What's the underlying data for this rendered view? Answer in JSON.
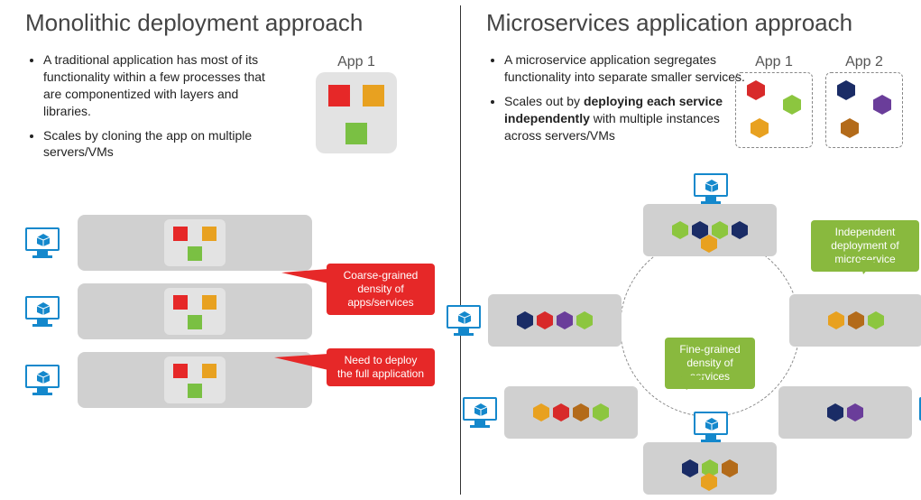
{
  "left": {
    "heading": "Monolithic deployment approach",
    "bullets": [
      "A traditional application has most of its functionality within a few processes that are componentized with layers and libraries.",
      "Scales by cloning the app on multiple servers/VMs"
    ],
    "app_label": "App 1",
    "callout1": "Coarse-grained density of apps/services",
    "callout2": "Need to deploy the full application"
  },
  "right": {
    "heading": "Microservices application approach",
    "bullet1": "A microservice application segregates functionality into separate smaller services.",
    "bullet2_pre": "Scales out by ",
    "bullet2_bold": "deploying each service independently",
    "bullet2_post": " with multiple instances across servers/VMs",
    "app1_label": "App 1",
    "app2_label": "App 2",
    "g_callout1": "Fine-grained density of services",
    "g_callout2": "Independent deployment of microservice"
  },
  "colors": {
    "red": "#e62828",
    "yellow": "#e8a120",
    "green": "#7ac043",
    "blue": "#1a2c66",
    "purple": "#6a3d9a",
    "brown": "#b36b1a",
    "monitor": "#1488cc",
    "callout_red": "#e62828",
    "callout_green": "#89b93e"
  }
}
